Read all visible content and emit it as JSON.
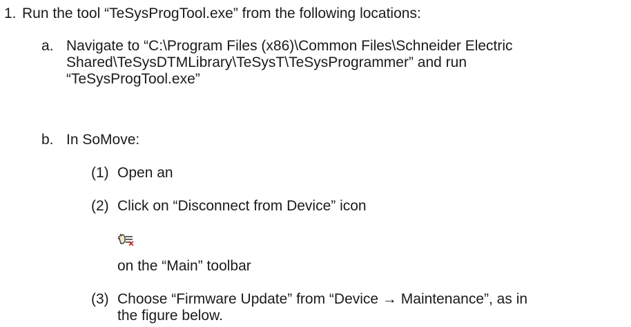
{
  "step1": {
    "number": "1.",
    "text": "Run the tool “TeSysProgTool.exe” from the following locations:"
  },
  "step_a": {
    "marker": "a.",
    "lines": [
      "Navigate to “C:\\Program Files (x86)\\Common Files\\Schneider Electric",
      "Shared\\TeSysDTMLibrary\\TeSysT\\TeSysProgrammer” and run",
      "“TeSysProgTool.exe”"
    ]
  },
  "step_b": {
    "marker": "b.",
    "text": "In SoMove:",
    "substeps": [
      {
        "marker": "(1)",
        "lines": [
          "Open an"
        ]
      },
      {
        "marker": "(2)",
        "lines": [
          "Click on “Disconnect from Device” icon"
        ],
        "icon": "disconnect-from-device-icon",
        "after_icon": "on the “Main” toolbar"
      },
      {
        "marker": "(3)",
        "lines": [
          "Choose “Firmware Update” from “Device → Maintenance”, as in",
          "the figure below."
        ]
      }
    ]
  }
}
